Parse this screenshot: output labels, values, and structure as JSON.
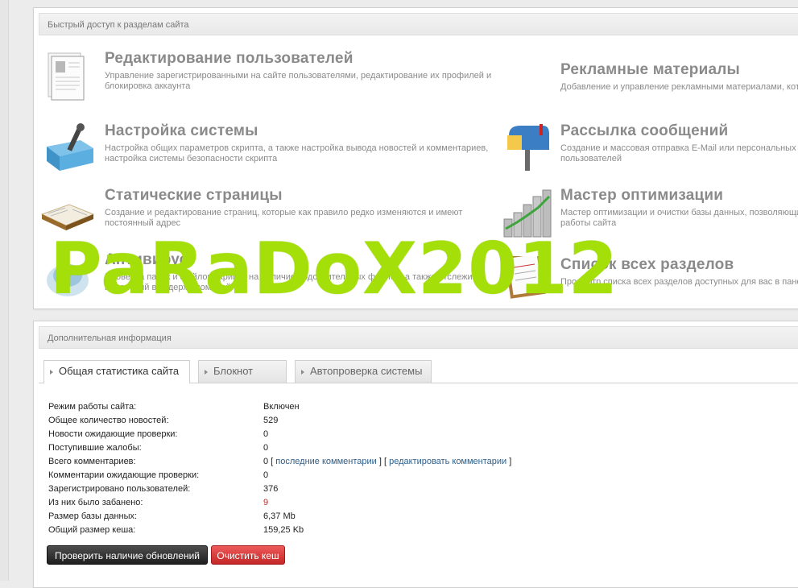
{
  "quick_access": {
    "title": "Быстрый доступ к разделам сайта",
    "items": [
      {
        "title": "Редактирование пользователей",
        "desc": "Управление зарегистрированными на сайте пользователями, редактирование их профилей и блокировка аккаунта"
      },
      {
        "title": "Рекламные материалы",
        "desc": "Добавление и управление рекламными материалами, кото"
      },
      {
        "title": "Настройка системы",
        "desc": "Настройка общих параметров скрипта, а также настройка вывода новостей и комментариев, настройка системы безопасности скрипта"
      },
      {
        "title": "Рассылка сообщений",
        "desc": "Создание и массовая отправка E-Mail или персональных сс пользователей"
      },
      {
        "title": "Статические страницы",
        "desc": "Создание и редактирование страниц, которые как правило редко изменяются и имеют постоянный адрес"
      },
      {
        "title": "Мастер оптимизации",
        "desc": "Мастер оптимизации и очистки базы данных, позволяющи работы сайта"
      },
      {
        "title": "Антивирус",
        "desc": "Проверка папок и файлов скрипта на наличие подозрительных файлов, а также отслежив изменений в содержимом файлов"
      },
      {
        "title": "Список всех разделов",
        "desc": "Просмотр списка всех разделов доступных для вас в панел"
      }
    ]
  },
  "watermark": "PaRaDoX2012",
  "extra": {
    "title": "Дополнительная информация",
    "tabs": [
      "Общая статистика сайта",
      "Блокнот",
      "Автопроверка системы"
    ]
  },
  "stats": [
    {
      "label": "Режим работы сайта:",
      "value": "Включен"
    },
    {
      "label": "Общее количество новостей:",
      "value": "529"
    },
    {
      "label": "Новости ожидающие проверки:",
      "value": "0"
    },
    {
      "label": "Поступившие жалобы:",
      "value": "0"
    },
    {
      "label": "Всего комментариев:",
      "value": "0"
    },
    {
      "label": "Комментарии ожидающие проверки:",
      "value": "0"
    },
    {
      "label": "Зарегистрировано пользователей:",
      "value": "376"
    },
    {
      "label": "Из них было забанено:",
      "value": "9"
    },
    {
      "label": "Размер базы данных:",
      "value": "6,37 Mb"
    },
    {
      "label": "Общий размер кеша:",
      "value": "159,25 Kb"
    }
  ],
  "comment_links": {
    "last": "последние комментарии",
    "edit": "редактировать комментарии"
  },
  "buttons": {
    "check_updates": "Проверить наличие обновлений",
    "clear_cache": "Очистить кеш"
  },
  "colors": {
    "watermark": "#a4df0a",
    "link": "#2e5e8a",
    "banned": "#c0292b",
    "title": "#8a8a8a"
  }
}
